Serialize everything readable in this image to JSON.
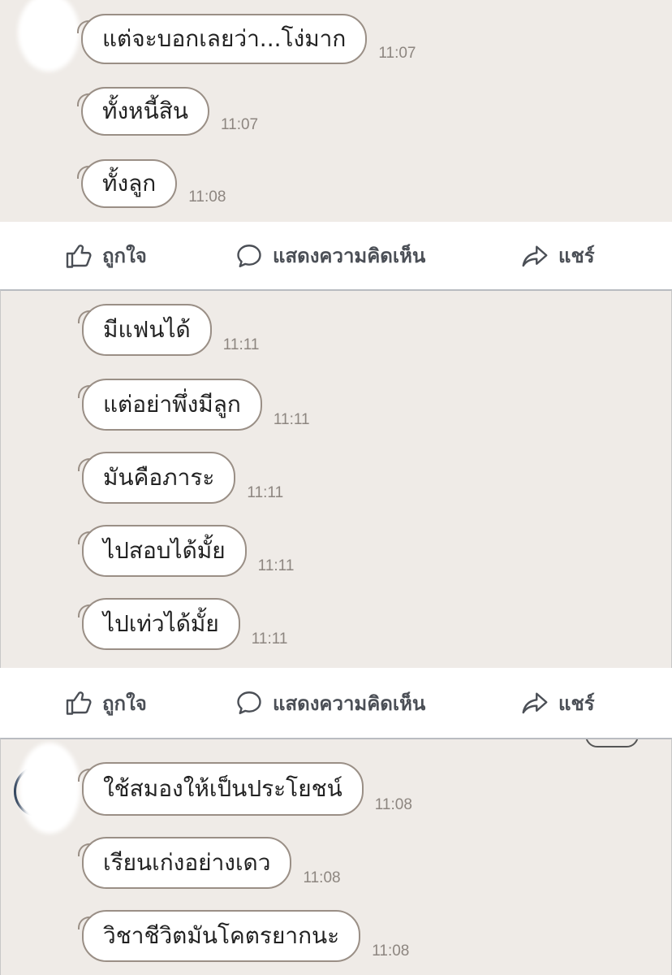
{
  "panel_1": {
    "messages": [
      {
        "text": "แต่จะบอกเลยว่า...โง่มาก",
        "time": "11:07"
      },
      {
        "text": "ทั้งหนี้สิน",
        "time": "11:07"
      },
      {
        "text": "ทั้งลูก",
        "time": "11:08"
      }
    ]
  },
  "bar_1": {
    "like_label": "ถูกใจ",
    "comment_label": "แสดงความคิดเห็น",
    "share_label": "แชร์"
  },
  "panel_2": {
    "messages": [
      {
        "text": "มีแฟนได้",
        "time": "11:11"
      },
      {
        "text": "แต่อย่าพึ่งมีลูก",
        "time": "11:11"
      },
      {
        "text": "มันคือภาระ",
        "time": "11:11"
      },
      {
        "text": "ไปสอบได้มั้ย",
        "time": "11:11"
      },
      {
        "text": "ไปเท่วได้มั้ย",
        "time": "11:11"
      }
    ]
  },
  "bar_2": {
    "like_label": "ถูกใจ",
    "comment_label": "แสดงความคิดเห็น",
    "share_label": "แชร์"
  },
  "panel_3": {
    "messages": [
      {
        "text": "ใช้สมองให้เป็นประโยชน์",
        "time": "11:08"
      },
      {
        "text": "เรียนเก่งอย่างเดว",
        "time": "11:08"
      },
      {
        "text": "วิชาชีวิตมันโคตรยากนะ",
        "time": "11:08"
      }
    ]
  },
  "icons": {
    "like": "thumbs-up-icon",
    "comment": "speech-bubble-icon",
    "share": "share-arrow-icon"
  },
  "colors": {
    "chat_background": "#efebe7",
    "bubble_border": "#9a8f86",
    "action_text": "#4b4f56"
  }
}
